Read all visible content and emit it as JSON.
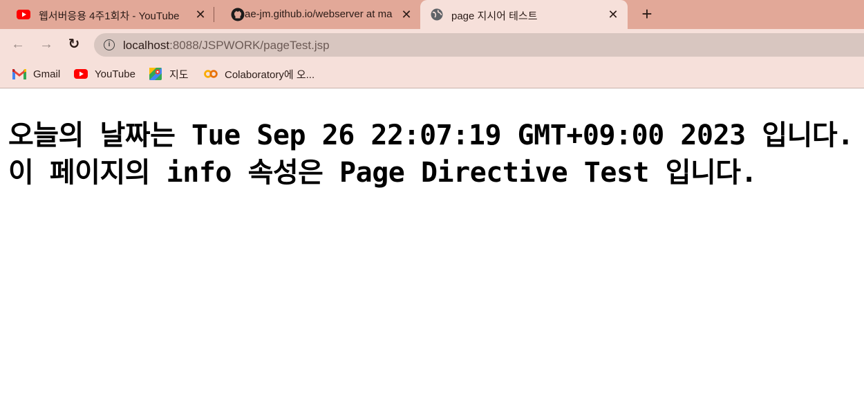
{
  "tabs": [
    {
      "title": "웹서버응용 4주1회차 - YouTube",
      "favicon": "youtube-icon"
    },
    {
      "title": "ae-jm.github.io/webserver at ma",
      "favicon": "github-icon"
    },
    {
      "title": "page 지시어 테스트",
      "favicon": "globe-icon",
      "active": true
    }
  ],
  "new_tab_label": "+",
  "close_label": "✕",
  "toolbar": {
    "back": "←",
    "forward": "→",
    "reload": "↻",
    "info": "i",
    "url_host": "localhost",
    "url_path": ":8088/JSPWORK/pageTest.jsp"
  },
  "bookmarks": [
    {
      "label": "Gmail",
      "icon": "gmail-icon"
    },
    {
      "label": "YouTube",
      "icon": "youtube-icon"
    },
    {
      "label": "지도",
      "icon": "maps-icon"
    },
    {
      "label": "Colaboratory에 오...",
      "icon": "colab-icon"
    }
  ],
  "content": {
    "line1": "오늘의 날짜는 Tue Sep 26 22:07:19 GMT+09:00 2023 입니다.",
    "line2": "이 페이지의 info 속성은 Page Directive Test 입니다."
  },
  "colors": {
    "tabstrip": "#e2a898",
    "toolbar": "#f6e0da",
    "youtube_red": "#ff0000"
  }
}
